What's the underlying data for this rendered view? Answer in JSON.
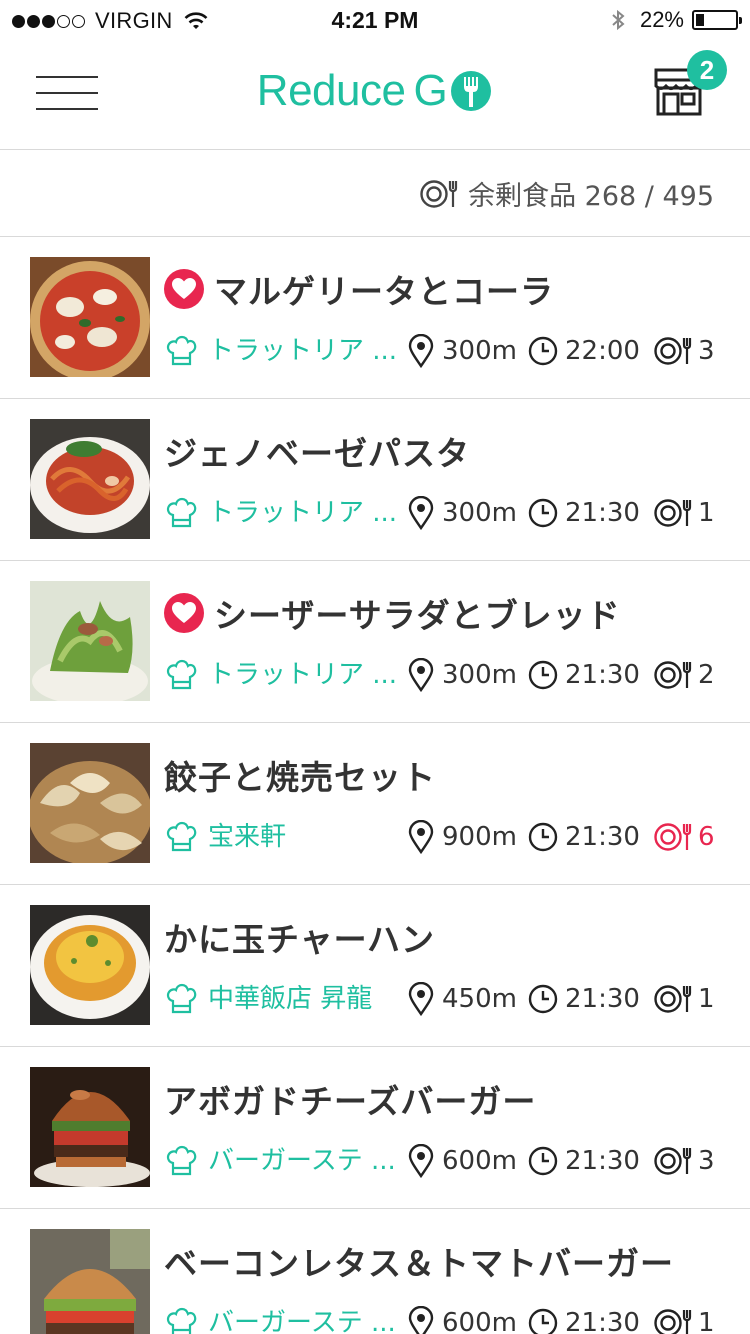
{
  "status_bar": {
    "carrier": "VIRGIN",
    "time": "4:21 PM",
    "battery_text": "22%",
    "battery_level": 0.22,
    "signal_bars_filled": 3,
    "signal_bars_total": 5
  },
  "header": {
    "logo_text": "Reduce",
    "logo_text_g": "G",
    "cart_count": "2",
    "store_icon": "store-icon",
    "menu_icon": "hamburger-icon"
  },
  "summary": {
    "label": "余剰食品 268 / 495",
    "icon": "plate-fork-icon"
  },
  "colors": {
    "accent": "#1fbfa0",
    "favorite": "#e8264f",
    "low_stock": "#e8264f",
    "text": "#333333",
    "divider": "#d9d9d9"
  },
  "items": [
    {
      "title": "マルゲリータとコーラ",
      "favorite": true,
      "shop": "トラットリア ...",
      "distance": "300m",
      "time": "22:00",
      "stock": "3",
      "low_stock": false
    },
    {
      "title": "ジェノベーゼパスタ",
      "favorite": false,
      "shop": "トラットリア ...",
      "distance": "300m",
      "time": "21:30",
      "stock": "1",
      "low_stock": false
    },
    {
      "title": "シーザーサラダとブレッド",
      "favorite": true,
      "shop": "トラットリア ...",
      "distance": "300m",
      "time": "21:30",
      "stock": "2",
      "low_stock": false
    },
    {
      "title": "餃子と焼売セット",
      "favorite": false,
      "shop": "宝来軒",
      "distance": "900m",
      "time": "21:30",
      "stock": "6",
      "low_stock": true
    },
    {
      "title": "かに玉チャーハン",
      "favorite": false,
      "shop": "中華飯店 昇龍",
      "distance": "450m",
      "time": "21:30",
      "stock": "1",
      "low_stock": false
    },
    {
      "title": "アボガドチーズバーガー",
      "favorite": false,
      "shop": "バーガーステ ...",
      "distance": "600m",
      "time": "21:30",
      "stock": "3",
      "low_stock": false
    },
    {
      "title": "ベーコンレタス＆トマトバーガー",
      "favorite": false,
      "shop": "バーガーステ ...",
      "distance": "600m",
      "time": "21:30",
      "stock": "1",
      "low_stock": false
    }
  ]
}
